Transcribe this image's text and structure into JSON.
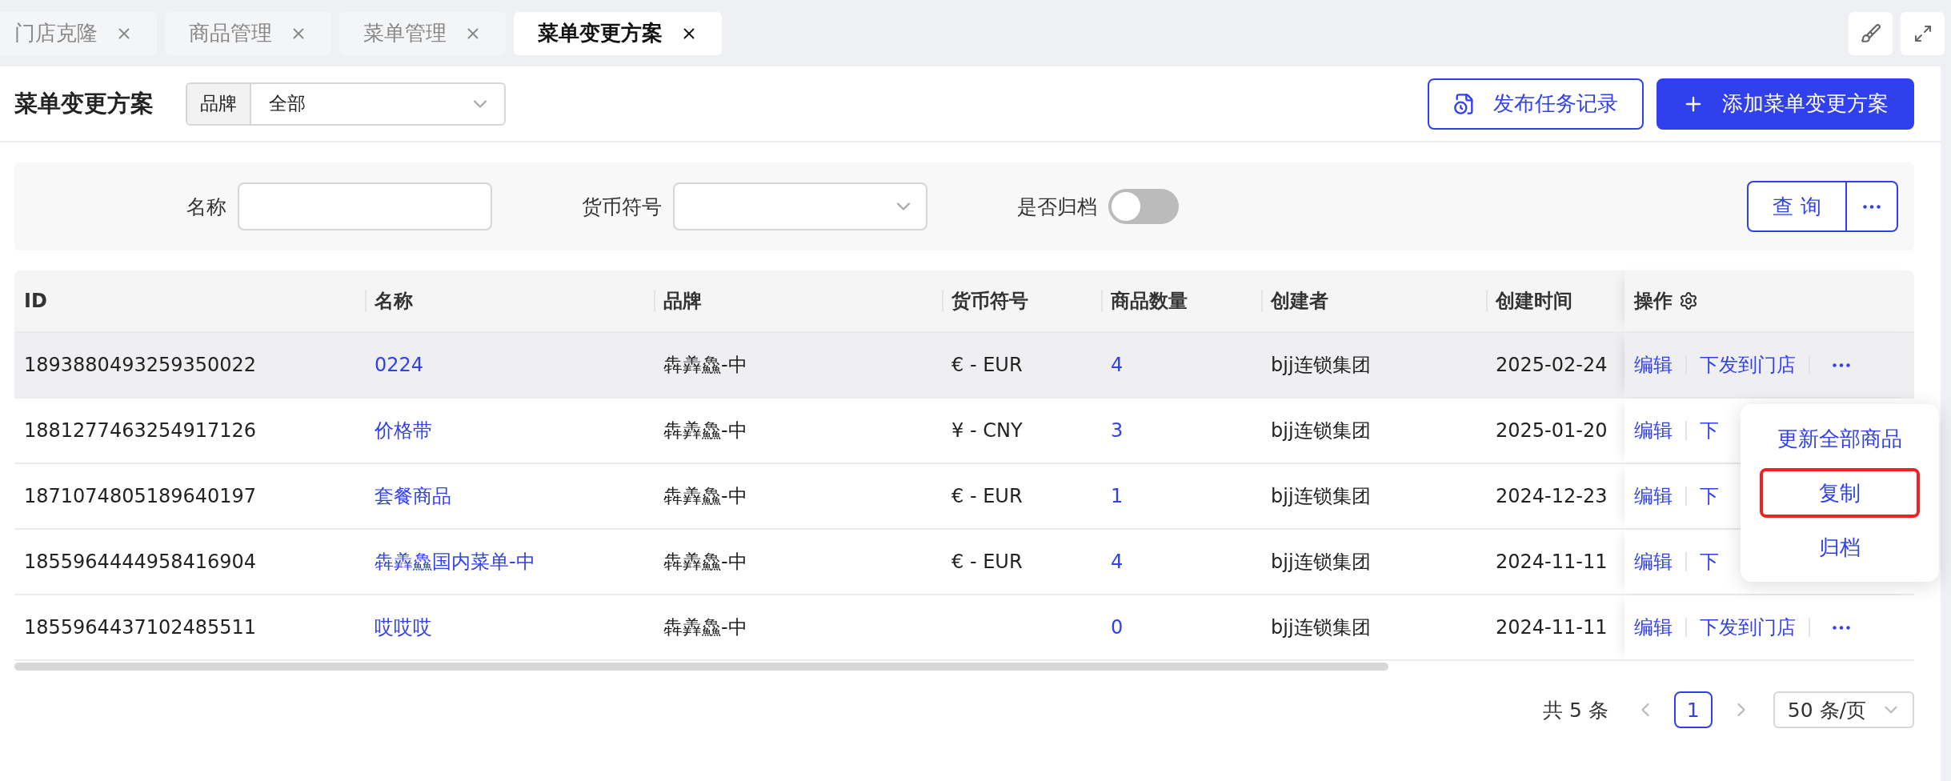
{
  "tabs": [
    {
      "label": "门店克隆",
      "selected": false
    },
    {
      "label": "商品管理",
      "selected": false
    },
    {
      "label": "菜单管理",
      "selected": false
    },
    {
      "label": "菜单变更方案",
      "selected": true
    }
  ],
  "header": {
    "title": "菜单变更方案",
    "brand_filter": {
      "label": "品牌",
      "value": "全部"
    },
    "buttons": [
      {
        "kind": "outline",
        "label": "发布任务记录"
      },
      {
        "kind": "primary",
        "label": "添加菜单变更方案"
      }
    ]
  },
  "filters": {
    "name": {
      "label": "名称"
    },
    "currency": {
      "label": "货币符号"
    },
    "archived": {
      "label": "是否归档",
      "on": false
    },
    "query_button": "查 询"
  },
  "table": {
    "columns": [
      "ID",
      "名称",
      "品牌",
      "货币符号",
      "商品数量",
      "创建者",
      "创建时间",
      "操作"
    ],
    "rows": [
      {
        "id": "1893880493259350022",
        "name": "0224",
        "brand": "犇羴鱻-中",
        "currency": "€ - EUR",
        "count": "4",
        "creator": "bjj连锁集团",
        "created": "2025-02-24",
        "actions": [
          "编辑",
          "下发到门店"
        ],
        "more": true,
        "hovered": true
      },
      {
        "id": "1881277463254917126",
        "name": "价格带",
        "brand": "犇羴鱻-中",
        "currency": "¥ - CNY",
        "count": "3",
        "creator": "bjj连锁集团",
        "created": "2025-01-20",
        "actions": [
          "编辑",
          "下"
        ],
        "more": false,
        "hovered": false
      },
      {
        "id": "1871074805189640197",
        "name": "套餐商品",
        "brand": "犇羴鱻-中",
        "currency": "€ - EUR",
        "count": "1",
        "creator": "bjj连锁集团",
        "created": "2024-12-23",
        "actions": [
          "编辑",
          "下"
        ],
        "more": false,
        "hovered": false
      },
      {
        "id": "1855964444958416904",
        "name": "犇羴鱻国内菜单-中",
        "brand": "犇羴鱻-中",
        "currency": "€ - EUR",
        "count": "4",
        "creator": "bjj连锁集团",
        "created": "2024-11-11",
        "actions": [
          "编辑",
          "下"
        ],
        "more": false,
        "hovered": false
      },
      {
        "id": "1855964437102485511",
        "name": "哎哎哎",
        "brand": "犇羴鱻-中",
        "currency": "",
        "count": "0",
        "creator": "bjj连锁集团",
        "created": "2024-11-11",
        "actions": [
          "编辑",
          "下发到门店"
        ],
        "more": true,
        "hovered": false
      }
    ]
  },
  "more_menu": [
    {
      "label": "更新全部商品",
      "highlighted": false
    },
    {
      "label": "复制",
      "highlighted": true
    },
    {
      "label": "归档",
      "highlighted": false
    }
  ],
  "pagination": {
    "total": "共 5 条",
    "pages": [
      {
        "label": "1",
        "selected": true
      }
    ],
    "page_size": "50 条/页"
  }
}
